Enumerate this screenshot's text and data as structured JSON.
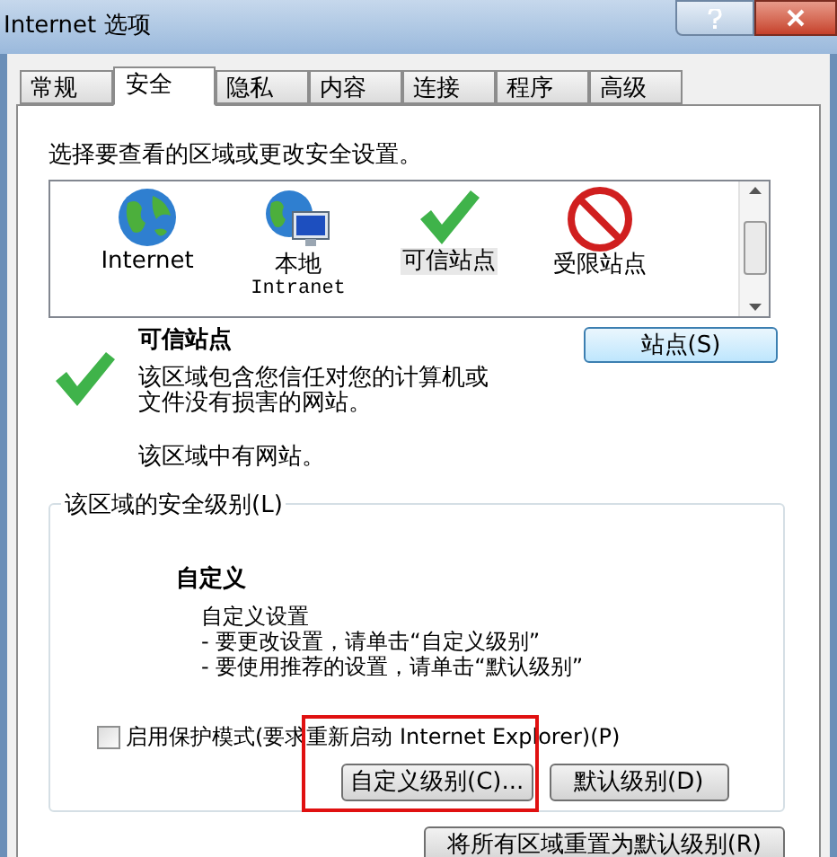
{
  "window": {
    "title": "Internet 选项"
  },
  "tabs": [
    {
      "label": "常规",
      "selected": false
    },
    {
      "label": "安全",
      "selected": true
    },
    {
      "label": "隐私",
      "selected": false
    },
    {
      "label": "内容",
      "selected": false
    },
    {
      "label": "连接",
      "selected": false
    },
    {
      "label": "程序",
      "selected": false
    },
    {
      "label": "高级",
      "selected": false
    }
  ],
  "instruction": "选择要查看的区域或更改安全设置。",
  "zones": [
    {
      "kind": "internet",
      "lines": [
        "Internet"
      ],
      "selected": false
    },
    {
      "kind": "intranet",
      "lines": [
        "本地",
        "Intranet"
      ],
      "selected": false
    },
    {
      "kind": "trusted",
      "lines": [
        "可信站点"
      ],
      "selected": true
    },
    {
      "kind": "restricted",
      "lines": [
        "受限站点"
      ],
      "selected": false
    }
  ],
  "zone_detail": {
    "title": "可信站点",
    "description_lines": [
      "该区域包含您信任对您的计算机或",
      "文件没有损害的网站。"
    ],
    "sites_note": "该区域中有网站。",
    "sites_button": "站点(S)"
  },
  "security_level": {
    "legend": "该区域的安全级别(L)",
    "level_name": "自定义",
    "lines": [
      "自定义设置",
      "- 要更改设置，请单击“自定义级别”",
      "- 要使用推荐的设置，请单击“默认级别”"
    ]
  },
  "protected_mode": {
    "label": "启用保护模式(要求重新启动 Internet Explorer)(P)",
    "checked": false
  },
  "level_buttons": [
    {
      "label": "自定义级别(C)...",
      "highlighted": true
    },
    {
      "label": "默认级别(D)",
      "highlighted": false
    }
  ],
  "reset_button": "将所有区域重置为默认级别(R)"
}
